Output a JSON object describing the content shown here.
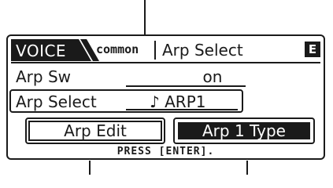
{
  "header": {
    "voice_tab": "VOICE",
    "sub_tab": "common",
    "page_title": "Arp Select",
    "mode_badge": "E"
  },
  "params": {
    "arp_sw": {
      "label": "Arp Sw",
      "value": "on"
    },
    "arp_select": {
      "label": "Arp Select",
      "value": "♪ ARP1"
    }
  },
  "buttons": {
    "arp_edit": "Arp Edit",
    "arp_type": "Arp 1 Type"
  },
  "hint": "PRESS [ENTER].",
  "colors": {
    "ink": "#1a1a1a",
    "background": "#ffffff"
  }
}
